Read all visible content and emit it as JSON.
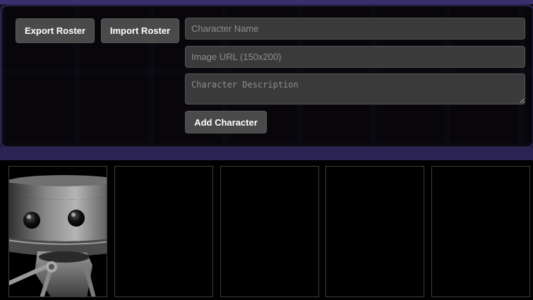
{
  "toolbar": {
    "export_label": "Export Roster",
    "import_label": "Import Roster"
  },
  "form": {
    "name_placeholder": "Character Name",
    "image_url_placeholder": "Image URL (150x200)",
    "description_placeholder": "Character Description",
    "add_label": "Add Character"
  },
  "roster": {
    "cards": [
      {
        "has_image": true,
        "image_subject": "robot-character-icon"
      },
      {
        "has_image": false
      },
      {
        "has_image": false
      },
      {
        "has_image": false
      },
      {
        "has_image": false
      }
    ]
  },
  "colors": {
    "button_bg": "#4a4a4a",
    "input_bg": "#3a3a3a",
    "accent_purple": "#2b2452",
    "page_bg": "#060509"
  }
}
